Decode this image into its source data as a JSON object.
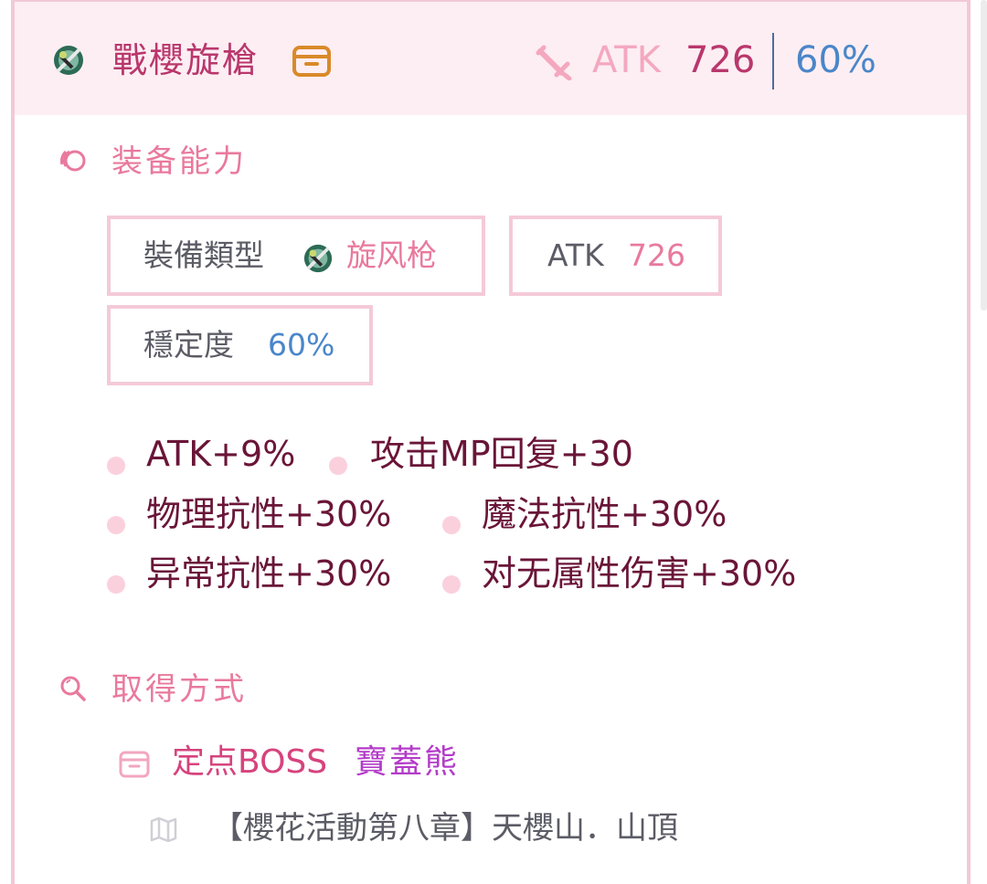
{
  "header": {
    "weapon_name": "戰櫻旋槍",
    "atk_label": "ATK",
    "atk_value": "726",
    "stability": "60%"
  },
  "ability_section": {
    "title": "装备能力",
    "type_label": "裝備類型",
    "type_value": "旋风枪",
    "atk_label": "ATK",
    "atk_value": "726",
    "stability_label": "穩定度",
    "stability_value": "60%"
  },
  "attributes": [
    "ATK+9%",
    "攻击MP回复+30",
    "物理抗性+30%",
    "魔法抗性+30%",
    "异常抗性+30%",
    "对无属性伤害+30%"
  ],
  "obtain_section": {
    "title": "取得方式",
    "source_type": "定点BOSS",
    "source_name": "寶蓋熊",
    "location": "【櫻花活動第八章】天櫻山．山頂"
  },
  "colors": {
    "accent_pink": "#e9799d",
    "deep_pink": "#b9376c",
    "blue": "#4a86c9",
    "purple": "#b33cc9",
    "box_border": "#f4cad8"
  },
  "icons": [
    "spear-weapon-icon",
    "chest-icon",
    "sword-icon",
    "swirl-icon",
    "search-icon",
    "map-icon"
  ]
}
